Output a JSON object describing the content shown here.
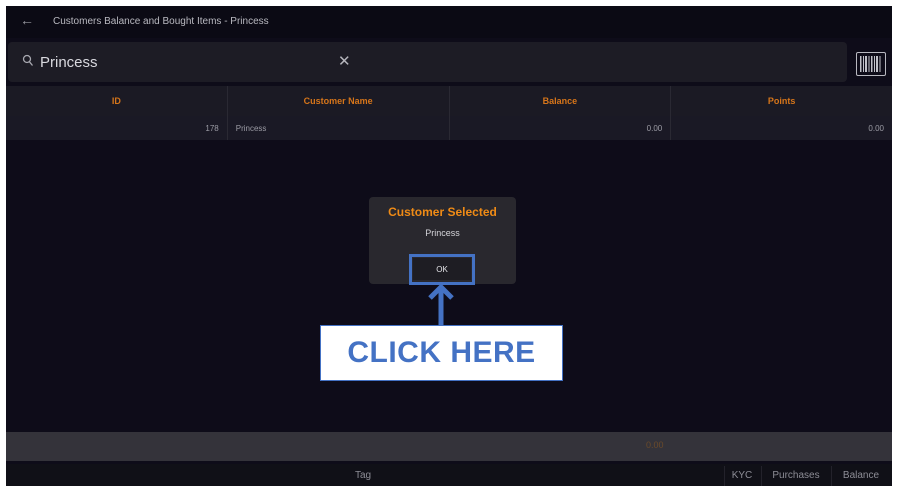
{
  "header": {
    "title": "Customers Balance and Bought Items - Princess"
  },
  "search": {
    "value": "Princess"
  },
  "table": {
    "columns": [
      "ID",
      "Customer Name",
      "Balance",
      "Points"
    ],
    "rows": [
      {
        "id": "178",
        "name": "Princess",
        "balance": "0.00",
        "points": "0.00"
      }
    ]
  },
  "dialog": {
    "title": "Customer Selected",
    "message": "Princess",
    "ok_label": "OK"
  },
  "callout": {
    "text": "CLICK HERE"
  },
  "footer": {
    "total": "0.00"
  },
  "bottom_tabs": {
    "tag": "Tag",
    "kyc": "KYC",
    "purchases": "Purchases",
    "balance": "Balance"
  },
  "colors": {
    "accent_orange": "#ef8b16",
    "highlight_blue": "#4472c4"
  }
}
